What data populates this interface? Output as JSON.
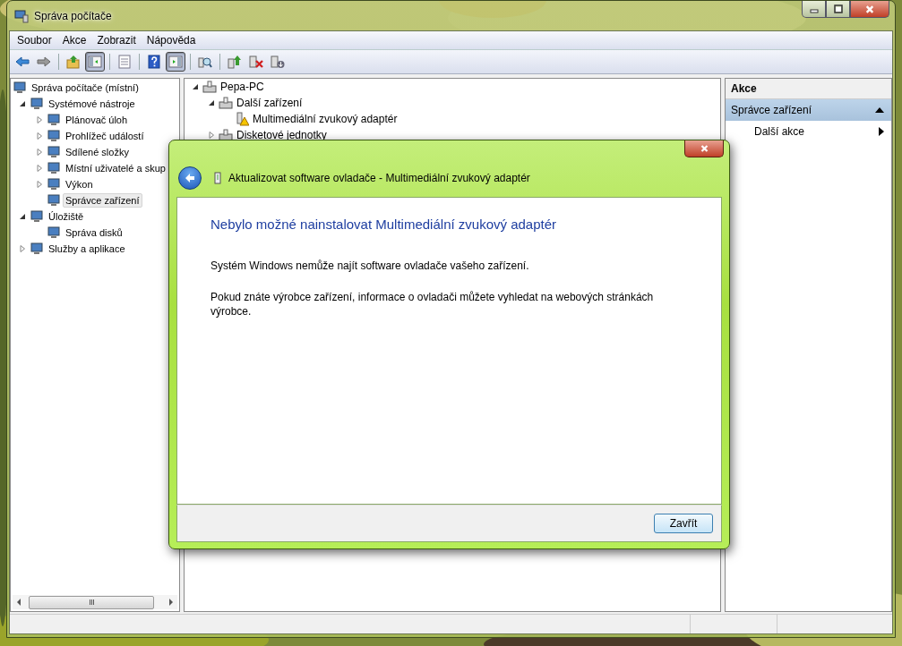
{
  "window": {
    "title": "Správa počítače"
  },
  "menu": [
    "Soubor",
    "Akce",
    "Zobrazit",
    "Nápověda"
  ],
  "toolbar": [
    {
      "kind": "back",
      "pressed": false
    },
    {
      "kind": "forward",
      "pressed": false
    },
    {
      "kind": "up",
      "pressed": false,
      "separator_before": true
    },
    {
      "kind": "tree",
      "pressed": true
    },
    {
      "kind": "list",
      "pressed": false,
      "separator_before": true
    },
    {
      "kind": "help",
      "pressed": false,
      "separator_before": true
    },
    {
      "kind": "pane",
      "pressed": true
    },
    {
      "kind": "scan",
      "pressed": false,
      "separator_before": true
    },
    {
      "kind": "update",
      "pressed": false,
      "separator_before": true
    },
    {
      "kind": "uninstall",
      "pressed": false
    },
    {
      "kind": "disable",
      "pressed": false
    }
  ],
  "left_tree": [
    {
      "label": "Správa počítače (místní)",
      "selected": false,
      "children": [
        {
          "label": "Systémové nástroje",
          "expanded": true,
          "selected": false,
          "children": [
            {
              "label": "Plánovač úloh",
              "expanded": false,
              "selected": false
            },
            {
              "label": "Prohlížeč událostí",
              "expanded": false,
              "selected": false
            },
            {
              "label": "Sdílené složky",
              "expanded": false,
              "selected": false
            },
            {
              "label": "Místní uživatelé a skup",
              "expanded": false,
              "selected": false
            },
            {
              "label": "Výkon",
              "expanded": false,
              "selected": false
            },
            {
              "label": "Správce zařízení",
              "selected": true
            }
          ]
        },
        {
          "label": "Úložiště",
          "expanded": true,
          "selected": false,
          "children": [
            {
              "label": "Správa disků",
              "selected": false
            }
          ]
        },
        {
          "label": "Služby a aplikace",
          "expanded": false,
          "selected": false
        }
      ]
    }
  ],
  "device_tree": [
    {
      "label": "Pepa-PC",
      "expanded": true,
      "children": [
        {
          "label": "Další zařízení",
          "expanded": true,
          "children": [
            {
              "label": "Multimediální zvukový adaptér",
              "warning": true
            }
          ]
        },
        {
          "label": "Disketové jednotky",
          "expanded": false
        }
      ]
    }
  ],
  "actions": {
    "header": "Akce",
    "section": {
      "label": "Správce zařízení",
      "expanded": true
    },
    "items": [
      "Další akce"
    ]
  },
  "dialog": {
    "title": "Aktualizovat software ovladače - Multimediální zvukový adaptér",
    "heading": "Nebylo možné nainstalovat Multimediální zvukový adaptér",
    "paragraphs": [
      "Systém Windows nemůže najít software ovladače vašeho zařízení.",
      "Pokud znáte výrobce zařízení, informace o ovladači můžete vyhledat na webových stránkách výrobce."
    ],
    "button": "Zavřít"
  }
}
